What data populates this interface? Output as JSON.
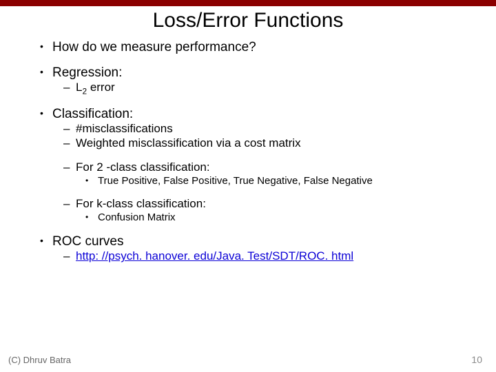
{
  "title": "Loss/Error Functions",
  "bullets": {
    "perf": "How do we measure performance?",
    "regression": "Regression:",
    "l2_prefix": "L",
    "l2_sub": "2",
    "l2_suffix": " error",
    "classification": "Classification:",
    "misclass": "#misclassifications",
    "weighted": "Weighted misclassification via a cost matrix",
    "two_class": "For 2 -class classification:",
    "tp_fp": "True Positive, False Positive, True Negative, False Negative",
    "k_class": "For k-class classification:",
    "confusion": "Confusion Matrix",
    "roc": "ROC curves",
    "roc_link": "http: //psych. hanover. edu/Java. Test/SDT/ROC. html"
  },
  "footer": {
    "copyright": "(C) Dhruv Batra",
    "page_number": "10"
  }
}
